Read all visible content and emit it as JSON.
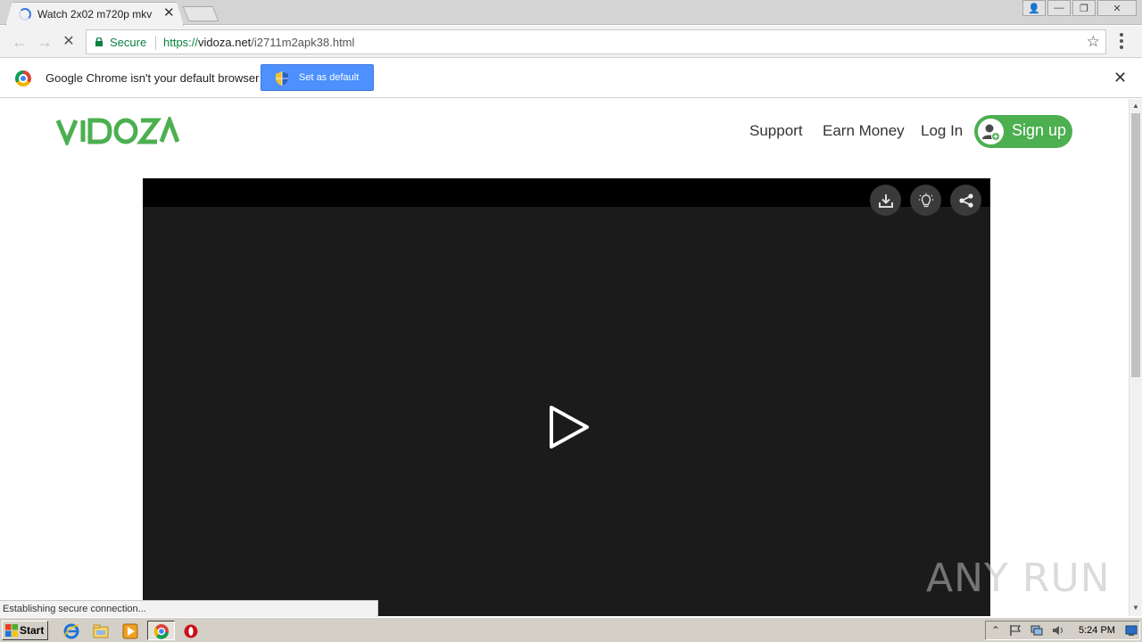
{
  "browser": {
    "tab": {
      "title": "Watch 2x02 m720p mkv",
      "close": "✕"
    },
    "window_controls": {
      "user": "👤",
      "minimize": "—",
      "restore": "❐",
      "close": "✕"
    },
    "toolbar": {
      "back": "←",
      "forward": "→",
      "stop": "✕",
      "secure_label": "Secure",
      "url_scheme": "https://",
      "url_host": "vidoza.net",
      "url_path": "/i2711m2apk38.html",
      "bookmark": "☆"
    },
    "infobar": {
      "message": "Google Chrome isn't your default browser",
      "button_label": "Set as default",
      "close": "✕"
    },
    "status_text": "Establishing secure connection...",
    "scroll_up": "▲",
    "scroll_down": "▼"
  },
  "site": {
    "nav": {
      "support": "Support",
      "earn_money": "Earn Money",
      "login": "Log In",
      "signup": "Sign up"
    },
    "brand_color": "#4caf50",
    "player": {
      "controls": [
        "download-icon",
        "lightbulb-icon",
        "share-icon"
      ]
    }
  },
  "watermark": "ANY RUN",
  "taskbar": {
    "start_label": "Start",
    "clock": "5:24 PM",
    "tray_arrow": "⌃"
  }
}
